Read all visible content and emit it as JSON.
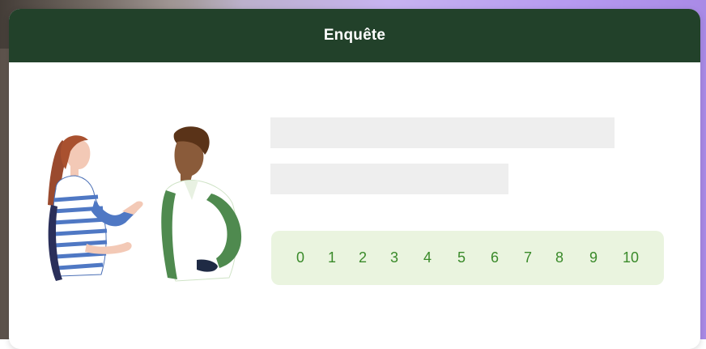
{
  "header": {
    "title": "Enquête"
  },
  "scale": {
    "options": [
      "0",
      "1",
      "2",
      "3",
      "4",
      "5",
      "6",
      "7",
      "8",
      "9",
      "10"
    ]
  },
  "colors": {
    "header_bg": "#22412a",
    "scale_bg": "#eaf4df",
    "scale_text": "#3a8a2a",
    "placeholder_bar": "#eeeeee"
  },
  "illustration": {
    "icon": "two-people-conversation-illustration"
  }
}
